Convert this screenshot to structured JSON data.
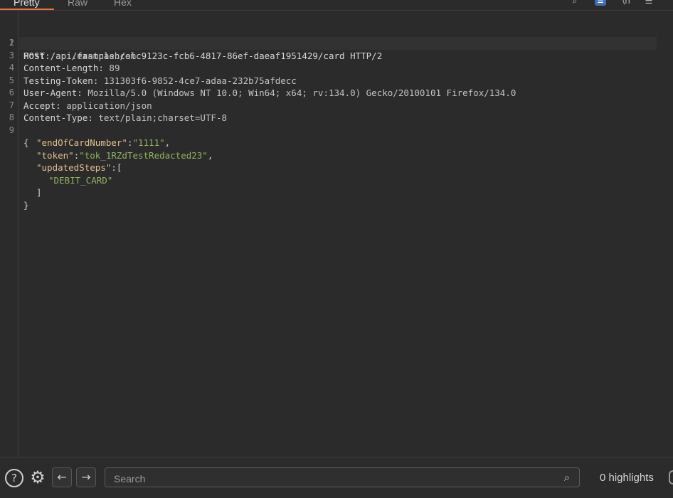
{
  "tabs": [
    {
      "label": "Pretty",
      "active": true
    },
    {
      "label": "Raw",
      "active": false
    },
    {
      "label": "Hex",
      "active": false
    }
  ],
  "toolbar_icons": [
    "search-icon",
    "wrap-lines-icon",
    "newline-icon",
    "menu-icon"
  ],
  "request": {
    "line_numbers": [
      "1",
      "2",
      "3",
      "4",
      "5",
      "6",
      "7",
      "8",
      "9"
    ],
    "request_line": "POST /api/fastcash/elc9123c-fcb6-4817-86ef-daeaf1951429/card HTTP/2",
    "headers": [
      {
        "name": "Host",
        "value": "api.example.com"
      },
      {
        "name": "Content-Length",
        "value": "89"
      },
      {
        "name": "Testing-Token",
        "value": "131303f6-9852-4ce7-adaa-232b75afdecc"
      },
      {
        "name": "User-Agent",
        "value": "Mozilla/5.0 (Windows NT 10.0; Win64; x64; rv:134.0) Gecko/20100101 Firefox/134.0"
      },
      {
        "name": "Accept",
        "value": "application/json"
      },
      {
        "name": "Content-Type",
        "value": "text/plain;charset=UTF-8"
      }
    ],
    "body": {
      "open_brace": "{",
      "end_of_card_key": "\"endOfCardNumber\"",
      "end_of_card_value": "\"1111\"",
      "token_key": "\"token\"",
      "token_value": "\"tok_1RZdTestRedacted23\"",
      "updated_steps_key": "\"updatedSteps\"",
      "open_bracket": "[",
      "step_value": "\"DEBIT_CARD\"",
      "close_bracket": "]",
      "close_brace": "}"
    }
  },
  "bottom": {
    "help_icon": "help-icon",
    "settings_icon": "gear-icon",
    "back_icon": "arrow-left-icon",
    "forward_icon": "arrow-right-icon",
    "search_placeholder": "Search",
    "highlights_label": "0 highlights"
  },
  "colors": {
    "background": "#2b2b2b",
    "tab_accent": "#e8743b",
    "json_key": "#e2c08d",
    "json_string": "#8fb35f"
  }
}
